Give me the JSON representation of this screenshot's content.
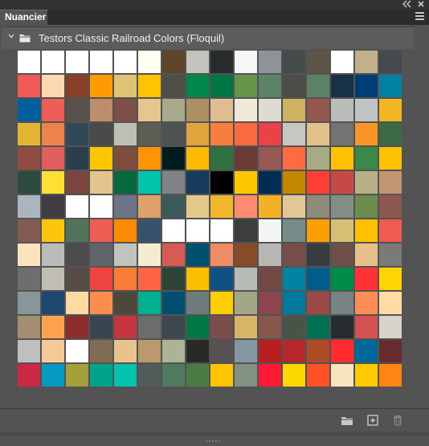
{
  "panel": {
    "tab_label": "Nuancier",
    "group_title": "Testors Classic Railroad Colors (Floquil)"
  },
  "icons": {
    "collapse": "double-chevron-left-icon",
    "close": "close-icon",
    "panel_menu": "hamburger-menu-icon",
    "disclosure": "chevron-down-icon",
    "folder": "folder-icon",
    "new_group": "folder-icon",
    "new_swatch": "add-swatch-icon",
    "delete": "trash-icon"
  },
  "colors": {
    "panel_bg": "#535353",
    "tab_bar_bg": "#2c2c2c",
    "text": "#f0f0f0"
  },
  "swatches": [
    [
      "#ffffff",
      "#ffffff",
      "#ffffff",
      "#ffffff",
      "#ffffff",
      "#fdfff0",
      "#5e4528",
      "#c2c3bd",
      "#272b2c",
      "#f4f6f8",
      "#8d9497",
      "#454d4a",
      "#5d5548",
      "#ffffff",
      "#c1b08b",
      "#444a4d"
    ],
    [
      "#ef5c57",
      "#fdd9b1",
      "#883f28",
      "#fe9a02",
      "#e0c273",
      "#ffc301",
      "#4f4f4a",
      "#00874b",
      "#007545",
      "#66944b",
      "#5b8367",
      "#4b4e47",
      "#5c8167",
      "#183148",
      "#003d76",
      "#00819f"
    ],
    [
      "#00609f",
      "#ef5d58",
      "#58514a",
      "#bd8d6e",
      "#7e4e49",
      "#e5c68e",
      "#a7ab8c",
      "#ad8f63",
      "#e0bd91",
      "#f2e8da",
      "#dedcd0",
      "#d0b362",
      "#93574e",
      "#b9bdb9",
      "#c1c4c4",
      "#f3b622"
    ],
    [
      "#e2b533",
      "#ec834f",
      "#304956",
      "#4a4a4a",
      "#bdbfb3",
      "#5d5d55",
      "#4f5253",
      "#dfa43e",
      "#f87d3e",
      "#fc6b3f",
      "#eb4148",
      "#c6c7c1",
      "#e2c18a",
      "#737371",
      "#f99627",
      "#3b6b44"
    ],
    [
      "#914c42",
      "#e05e5d",
      "#2a3f4e",
      "#fcc700",
      "#7e4c3d",
      "#ff9403",
      "#001c1e",
      "#fdba04",
      "#2f703f",
      "#6b3b35",
      "#975853",
      "#ff6a42",
      "#a6ab86",
      "#ffc100",
      "#3b8948",
      "#ffc200"
    ],
    [
      "#2e4b3f",
      "#fde032",
      "#7d4540",
      "#e1c58d",
      "#05693b",
      "#00c4a9",
      "#818484",
      "#163b5c",
      "#000000",
      "#fec800",
      "#002d55",
      "#c48700",
      "#fd3f36",
      "#c54a45",
      "#b8b187",
      "#c29572"
    ],
    [
      "#abb5c0",
      "#3f3d40",
      "#ffffff",
      "#ffffff",
      "#6d7588",
      "#dca26a",
      "#3e5959",
      "#e3c989",
      "#f2b629",
      "#fc8b72",
      "#f3b126",
      "#e3c697",
      "#8e8a78",
      "#808e85",
      "#6c8c4e",
      "#8c5850"
    ],
    [
      "#825a53",
      "#ffc50c",
      "#50735a",
      "#ef5e55",
      "#fd8b00",
      "#38526c",
      "#ffffff",
      "#ffffff",
      "#ffffff",
      "#3c3e3d",
      "#f4f6f6",
      "#778c88",
      "#fd9f00",
      "#d6bf73",
      "#ffc000",
      "#ef5b4e"
    ],
    [
      "#fbe4bc",
      "#b9bcb9",
      "#4b4b4b",
      "#606569",
      "#c1c3bf",
      "#f2edd0",
      "#d85a55",
      "#00506e",
      "#ef8c64",
      "#864b27",
      "#b7b8b3",
      "#764e49",
      "#373d3f",
      "#6f4f49",
      "#e6bf8b",
      "#7a7b78"
    ],
    [
      "#6e6e6e",
      "#c0bdb5",
      "#584c49",
      "#f04441",
      "#f77c35",
      "#fe6643",
      "#2c4335",
      "#fcbf00",
      "#0f5184",
      "#b9bbb7",
      "#744843",
      "#02839f",
      "#005d8b",
      "#008c46",
      "#ff3237",
      "#ffd500"
    ],
    [
      "#87969a",
      "#1e466f",
      "#ffdaa0",
      "#fd8d4d",
      "#4d4938",
      "#00b090",
      "#004e70",
      "#6e7b7c",
      "#ffcd00",
      "#a3a788",
      "#8d464d",
      "#00799c",
      "#9a4947",
      "#7a8383",
      "#fe8d57",
      "#ffdca4"
    ],
    [
      "#a48e72",
      "#fea34d",
      "#8d2d2c",
      "#3a4552",
      "#c5363f",
      "#6b6d6a",
      "#3e474d",
      "#007745",
      "#7b4e4d",
      "#d5b668",
      "#87574d",
      "#495449",
      "#007054",
      "#262b2d",
      "#d35151",
      "#d6d4cb"
    ],
    [
      "#bfbfbd",
      "#f5ca95",
      "#ffffff",
      "#7f6c52",
      "#e8c38e",
      "#ba9a6c",
      "#abb495",
      "#292925",
      "#595151",
      "#8596a3",
      "#b81d20",
      "#b5262d",
      "#af4a27",
      "#ff2b2d",
      "#00679a",
      "#672b30"
    ],
    [
      "#cb2845",
      "#049ac2",
      "#a5a03b",
      "#00a38c",
      "#00c4ab",
      "#535a5a",
      "#4f7a5e",
      "#4c7a45",
      "#ffc600",
      "#819284",
      "#ff1934",
      "#fcd800",
      "#ff5228",
      "#f9e4c0",
      "#ffcb00",
      "#ff8414"
    ]
  ]
}
